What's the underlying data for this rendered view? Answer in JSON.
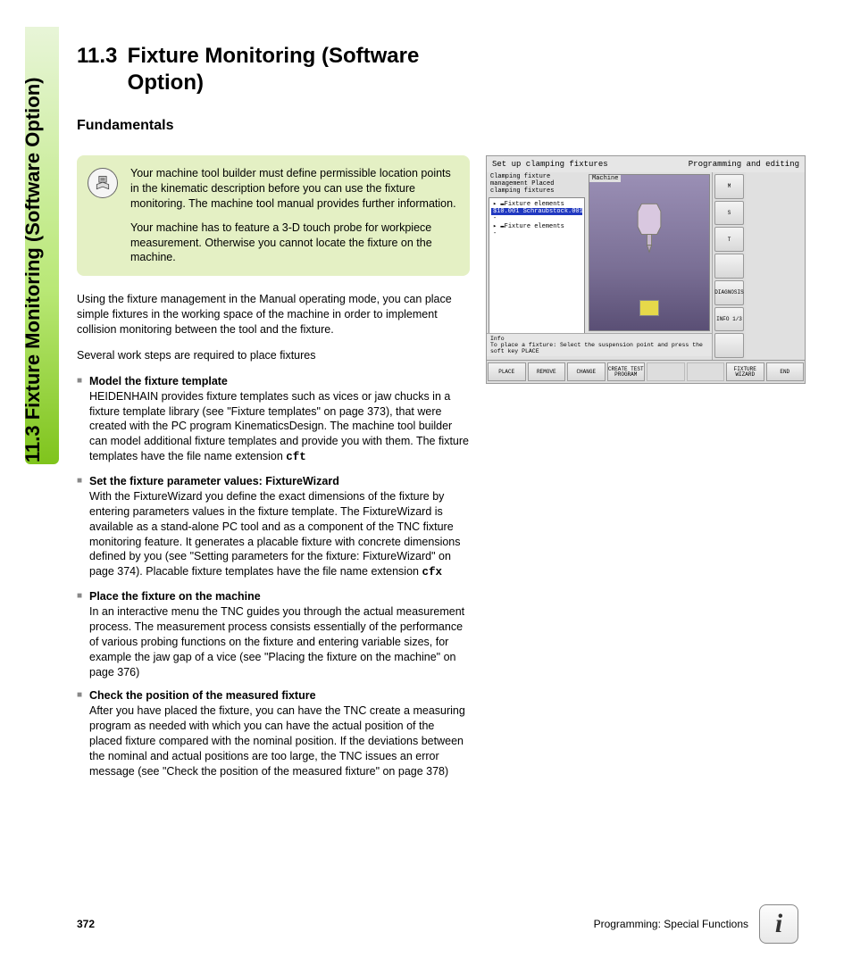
{
  "side_heading": "11.3 Fixture Monitoring (Software Option)",
  "heading_number": "11.3",
  "heading_text": "Fixture Monitoring (Software Option)",
  "subheading": "Fundamentals",
  "note": {
    "p1": "Your machine tool builder must define permissible location points in the kinematic description before you can use the fixture monitoring. The machine tool manual provides further information.",
    "p2": "Your machine has to feature a 3-D touch probe for workpiece measurement. Otherwise you cannot locate the fixture on the machine."
  },
  "para1": "Using the fixture management in the Manual operating mode, you can place simple fixtures in the working space of the machine in order to implement collision monitoring between the tool and the fixture.",
  "para2": "Several work steps are required to place fixtures",
  "steps": [
    {
      "title": "Model the fixture template",
      "body_pre": "HEIDENHAIN provides fixture templates such as vices or jaw chucks in a fixture template library (see \"Fixture templates\" on page 373), that were created with the PC program KinematicsDesign. The machine tool builder can model additional fixture templates and provide you with them. The fixture templates have the file name extension ",
      "mono": "cft",
      "body_post": ""
    },
    {
      "title": "Set the fixture parameter values: FixtureWizard",
      "body_pre": "With the FixtureWizard you define the exact dimensions of the fixture by entering parameters values in the fixture template. The FixtureWizard is available as a stand-alone PC tool and as a component of the TNC fixture monitoring feature. It generates a placable fixture with concrete dimensions defined by you (see \"Setting parameters for the fixture: FixtureWizard\" on page 374). Placable fixture templates have the file name extension ",
      "mono": "cfx",
      "body_post": ""
    },
    {
      "title": "Place the fixture on the machine",
      "body_pre": "In an interactive menu the TNC guides you through the actual measurement process. The measurement process consists essentially of the performance of various probing functions on the fixture and entering variable sizes, for example the jaw gap of a vice (see \"Placing the fixture on the machine\" on page 376)",
      "mono": "",
      "body_post": ""
    },
    {
      "title": "Check the position of the measured fixture",
      "body_pre": "After you have placed the fixture, you can have the TNC create a measuring program as needed with which you can have the actual position of the placed fixture compared with the nominal position. If the deviations between the nominal and actual positions are too large, the TNC issues an error message (see \"Check the position of the measured fixture\" on page 378)",
      "mono": "",
      "body_post": ""
    }
  ],
  "screenshot": {
    "title_left": "Set up clamping fixtures",
    "title_right": "Programming and editing",
    "tree_header": "Clamping fixture management\nPlaced clamping fixtures",
    "tree_lines": [
      "▸ ▬Fixture elements",
      "   $10.001 Schraubstock.001",
      "-",
      "▸ ▬Fixture elements",
      "   -"
    ],
    "view_label": "Machine",
    "info_label": "Info",
    "info_text": "To place a fixture: Select the suspension point and press the soft key PLACE",
    "side_buttons": [
      "M",
      "S",
      "T",
      "",
      "DIAGNOSIS",
      "INFO 1/3",
      ""
    ],
    "softkeys": [
      "PLACE",
      "REMOVE",
      "CHANGE",
      "CREATE TEST PROGRAM",
      "",
      "",
      "FIXTURE WIZARD",
      "END"
    ]
  },
  "footer": {
    "page": "372",
    "chapter": "Programming: Special Functions"
  }
}
